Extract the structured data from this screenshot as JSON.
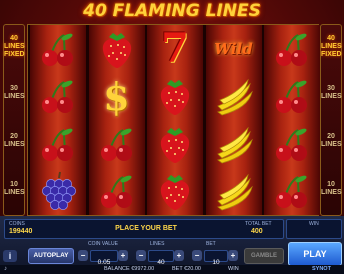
{
  "title": "40 FLAMING LINES",
  "sidebar": {
    "left": [
      "40 LINES FIXED",
      "30 LINES",
      "20 LINES",
      "10 LINES"
    ],
    "right": [
      "40 LINES FIXED",
      "30 LINES",
      "20 LINES",
      "10 LINES"
    ]
  },
  "reels": [
    [
      "cherry-icon",
      "cherry-icon",
      "cherry-icon",
      "grapes-icon"
    ],
    [
      "strawberry-icon",
      "dollar-icon",
      "cherry-icon",
      "cherry-icon"
    ],
    [
      "seven-icon",
      "strawberry-icon",
      "strawberry-icon",
      "strawberry-icon"
    ],
    [
      "wild-icon",
      "banana-icon",
      "banana-icon",
      "banana-icon"
    ],
    [
      "cherry-icon",
      "cherry-icon",
      "cherry-icon",
      "cherry-icon"
    ]
  ],
  "wild_text": "Wild",
  "seven_text": "7",
  "dollar_text": "$",
  "info": {
    "coins_label": "COINS",
    "coins_value": "199440",
    "message": "PLACE YOUR BET",
    "total_bet_label": "TOTAL BET",
    "total_bet_value": "400",
    "win_label": "WIN"
  },
  "controls": {
    "autoplay": "AUTOPLAY",
    "coin_value_label": "COIN VALUE",
    "coin_value": "0.05",
    "lines_label": "LINES",
    "lines": "40",
    "bet_label": "BET",
    "bet": "10",
    "gamble": "GAMBLE",
    "play": "PLAY",
    "minus": "−",
    "plus": "+"
  },
  "footer": {
    "balance": "BALANCE €9972.00",
    "bet": "BET €20.00",
    "win": "WIN",
    "brand": "SYNOT"
  }
}
